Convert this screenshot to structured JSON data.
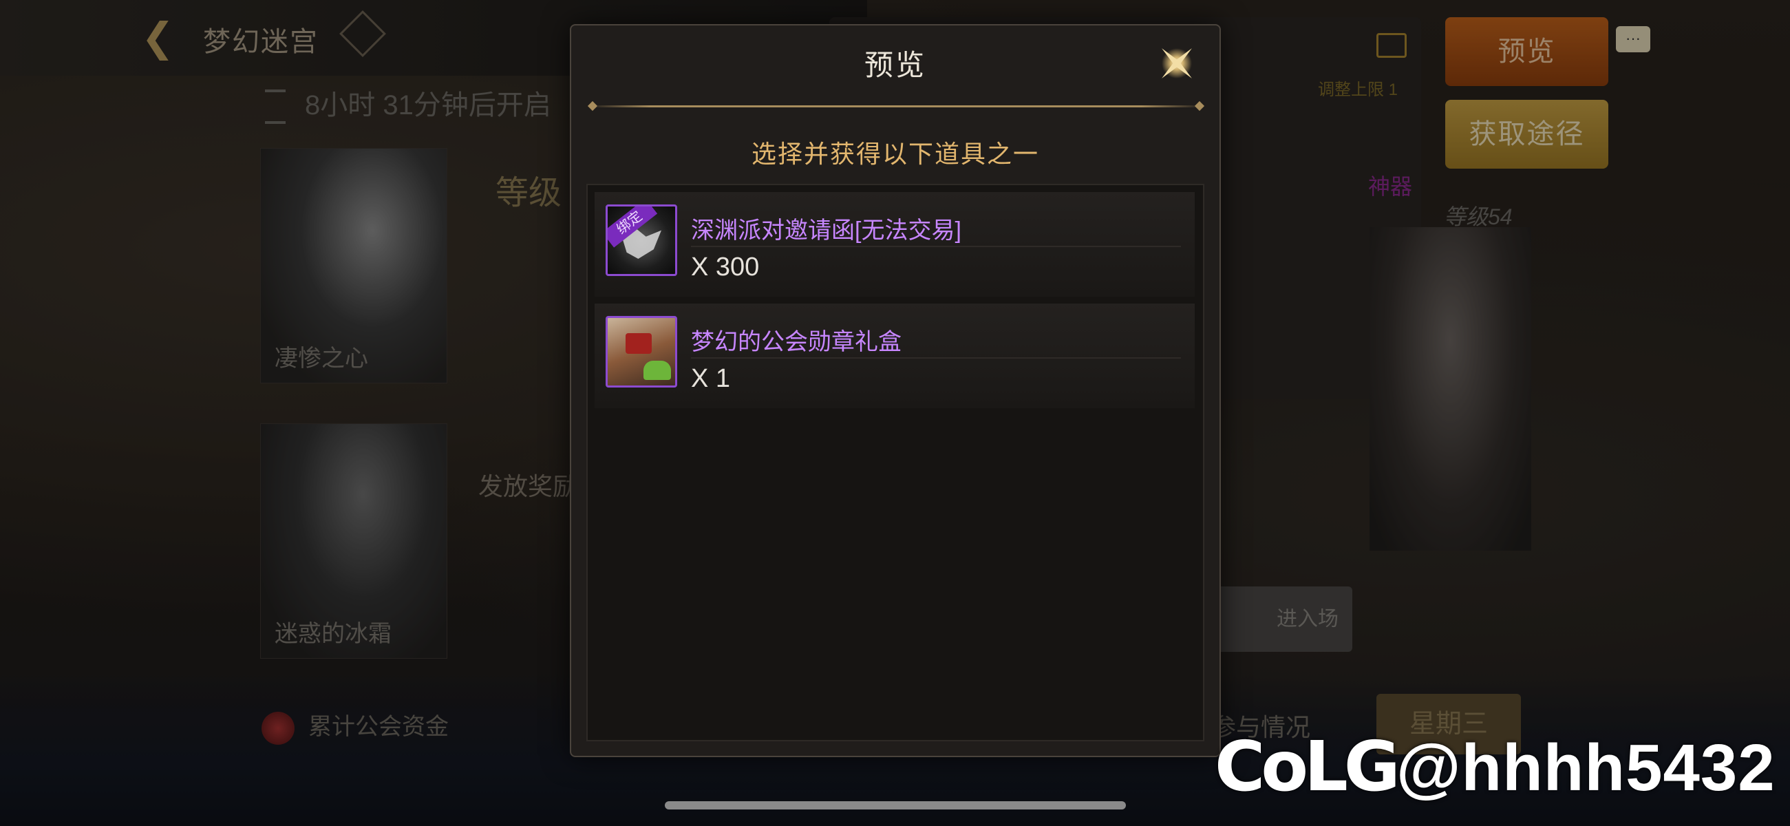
{
  "background": {
    "header_title": "梦幻迷宫",
    "timer_text": "8小时 31分钟后开启",
    "level_tag": "等级",
    "card1_label": "凄惨之心",
    "card2_label": "迷惑的冰霜",
    "reward_text": "发放奖励",
    "guild_fund": "累计公会资金",
    "max_text": "调整上限 1",
    "artifact_label": "神器",
    "level_text": "等级54",
    "enter_label": "进入场",
    "participation": "参与情况",
    "weekday": "星期三",
    "preview_button": "预览",
    "obtain_button": "获取途径",
    "chat_icon_text": "···"
  },
  "modal": {
    "title": "预览",
    "subtitle": "选择并获得以下道具之一",
    "items": [
      {
        "name": "深渊派对邀请函[无法交易]",
        "quantity": "X 300",
        "badge": "绑定",
        "icon": "abyss-invitation-icon"
      },
      {
        "name": "梦幻的公会勋章礼盒",
        "quantity": "X 1",
        "icon": "guild-medal-box-icon"
      }
    ]
  },
  "watermark": {
    "logo": "CoLG",
    "handle": "@hhhh5432"
  },
  "colors": {
    "accent_gold": "#e2b66e",
    "item_purple": "#c786ff",
    "preview_orange": "#c1621b",
    "obtain_gold": "#c8a144"
  }
}
